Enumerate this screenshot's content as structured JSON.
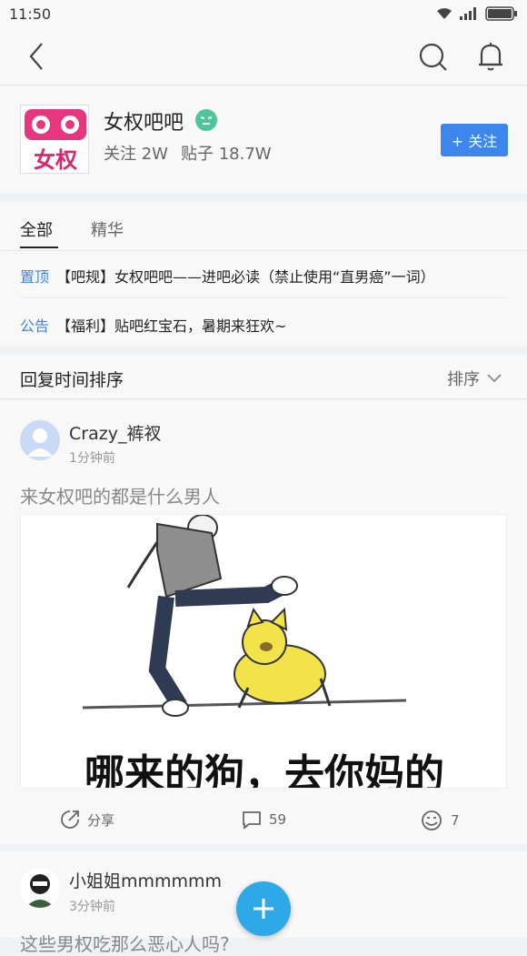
{
  "status_bar": {
    "time": "11:50"
  },
  "forum": {
    "name": "女权吧吧",
    "logo_text_top": "",
    "logo_text": "女权",
    "follow_count_label": "关注 2W",
    "post_count_label": "贴子 18.7W",
    "follow_button": "+ 关注"
  },
  "tabs": [
    {
      "label": "全部"
    },
    {
      "label": "精华"
    }
  ],
  "notices": [
    {
      "tag": "置顶",
      "text": "【吧规】女权吧吧——进吧必读（禁止使用“直男癌”一词）"
    },
    {
      "tag": "公告",
      "text": "【福利】贴吧红宝石，暑期来狂欢~"
    }
  ],
  "sort": {
    "title": "回复时间排序",
    "button": "排序"
  },
  "posts": [
    {
      "username": "Crazy_裤衩",
      "time": "1分钟前",
      "title": "来女权吧的都是什么男人",
      "image_caption": "哪来的狗，去你妈的",
      "share_label": "分享",
      "comments": "59",
      "likes": "7"
    },
    {
      "username": "小姐姐mmmmmm",
      "time": "3分钟前",
      "title": "这些男权吃那么恶心人吗?"
    }
  ],
  "colors": {
    "accent": "#3c86ec",
    "fab": "#2ea9e8"
  }
}
